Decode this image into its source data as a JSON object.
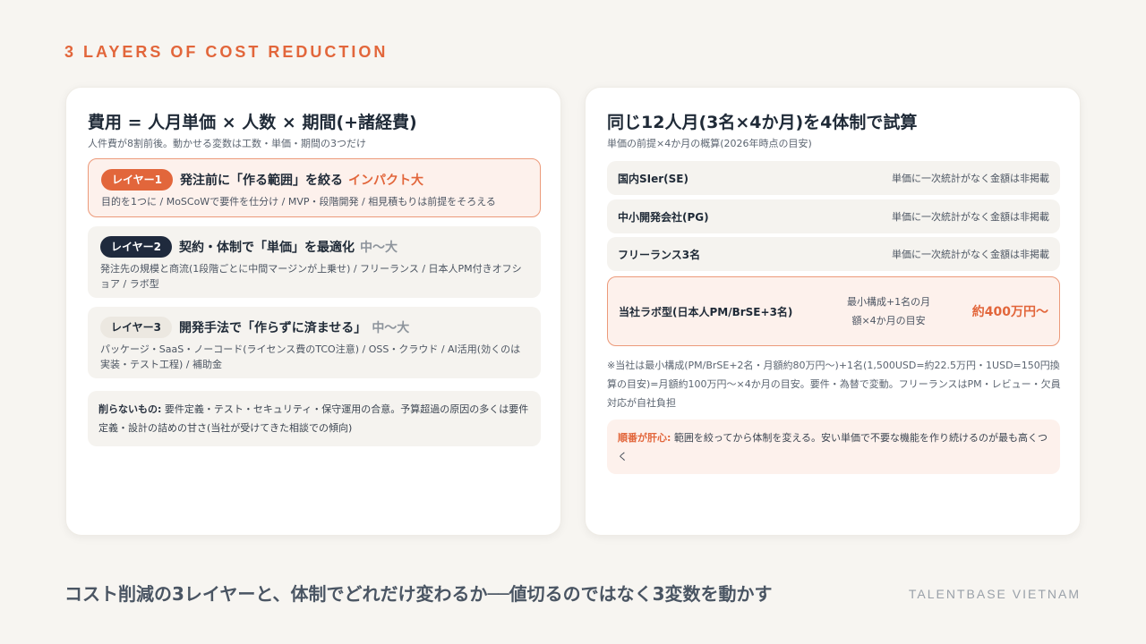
{
  "eyebrow": "3 LAYERS OF COST REDUCTION",
  "left": {
    "title": "費用 = 人月単価 × 人数 × 期間(+諸経費)",
    "subtitle": "人件費が8割前後。動かせる変数は工数・単価・期間の3つだけ",
    "layers": [
      {
        "tag": "レイヤー1",
        "title": "発注前に「作る範囲」を絞る",
        "impact": "インパクト大",
        "body": "目的を1つに / MoSCoWで要件を仕分け / MVP・段階開発 / 相見積もりは前提をそろえる"
      },
      {
        "tag": "レイヤー2",
        "title": "契約・体制で「単価」を最適化",
        "impact": "中〜大",
        "body": "発注先の規模と商流(1段階ごとに中間マージンが上乗せ) / フリーランス / 日本人PM付きオフショア / ラボ型"
      },
      {
        "tag": "レイヤー3",
        "title": "開発手法で「作らずに済ませる」",
        "impact": "中〜大",
        "body": "パッケージ・SaaS・ノーコード(ライセンス費のTCO注意) / OSS・クラウド / AI活用(効くのは実装・テスト工程) / 補助金"
      }
    ],
    "note_label": "削らないもの:",
    "note_text": " 要件定義・テスト・セキュリティ・保守運用の合意。予算超過の原因の多くは要件定義・設計の詰めの甘さ(当社が受けてきた相談での傾向)"
  },
  "right": {
    "title": "同じ12人月(3名×4か月)を4体制で試算",
    "subtitle": "単価の前提×4か月の概算(2026年時点の目安)",
    "rows": [
      {
        "name": "国内SIer(SE)",
        "value": "単価に一次統計がなく金額は非掲載"
      },
      {
        "name": "中小開発会社(PG)",
        "value": "単価に一次統計がなく金額は非掲載"
      },
      {
        "name": "フリーランス3名",
        "value": "単価に一次統計がなく金額は非掲載"
      }
    ],
    "ours": {
      "name": "当社ラボ型(日本人PM/BrSE+3名)",
      "mid": "最小構成+1名の月額×4か月の目安",
      "price": "約400万円〜"
    },
    "footnote": "※当社は最小構成(PM/BrSE+2名・月額約80万円〜)+1名(1,500USD=約22.5万円・1USD=150円換算の目安)=月額約100万円〜×4か月の目安。要件・為替で変動。フリーランスはPM・レビュー・欠員対応が自社負担",
    "tip_label": "順番が肝心:",
    "tip_text": " 範囲を絞ってから体制を変える。安い単価で不要な機能を作り続けるのが最も高くつく"
  },
  "footer": "コスト削減の3レイヤーと、体制でどれだけ変わるか──値切るのではなく3変数を動かす",
  "brand": "TALENTBASE VIETNAM",
  "colors": {
    "accent": "#e2663b",
    "navy": "#1f2a3d",
    "background": "#f7f5f1"
  }
}
